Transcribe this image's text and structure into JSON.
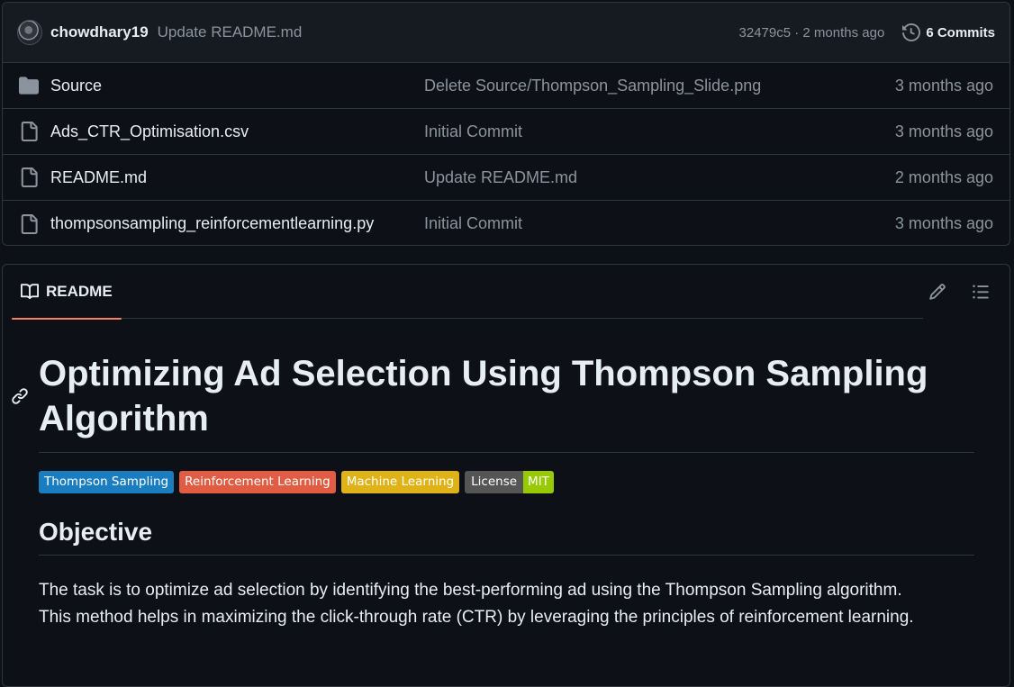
{
  "commit": {
    "author": "chowdhary19",
    "message": "Update README.md",
    "meta": "32479c5 · 2 months ago",
    "commits_label": "6 Commits"
  },
  "files": [
    {
      "type": "folder",
      "name": "Source",
      "message": "Delete Source/Thompson_Sampling_Slide.png",
      "date": "3 months ago"
    },
    {
      "type": "file",
      "name": "Ads_CTR_Optimisation.csv",
      "message": "Initial Commit",
      "date": "3 months ago"
    },
    {
      "type": "file",
      "name": "README.md",
      "message": "Update README.md",
      "date": "2 months ago"
    },
    {
      "type": "file",
      "name": "thompsonsampling_reinforcementlearning.py",
      "message": "Initial Commit",
      "date": "3 months ago"
    }
  ],
  "readme": {
    "tab_label": "README",
    "title": "Optimizing Ad Selection Using Thompson Sampling Algorithm",
    "badges": [
      {
        "label": "Thompson Sampling",
        "color": "#1a7dc0"
      },
      {
        "label": "Reinforcement Learning",
        "color": "#e05d44"
      },
      {
        "label": "Machine Learning",
        "color": "#dfb317"
      }
    ],
    "license_badge": {
      "left": "License",
      "right": "MIT"
    },
    "section_heading": "Objective",
    "paragraph_line1": "The task is to optimize ad selection by identifying the best-performing ad using the Thompson Sampling algorithm.",
    "paragraph_line2": "This method helps in maximizing the click-through rate (CTR) by leveraging the principles of reinforcement learning."
  },
  "colors": {
    "background": "#0d1117",
    "border": "#30363d",
    "accent": "#f78166",
    "muted_text": "#8b949e"
  }
}
